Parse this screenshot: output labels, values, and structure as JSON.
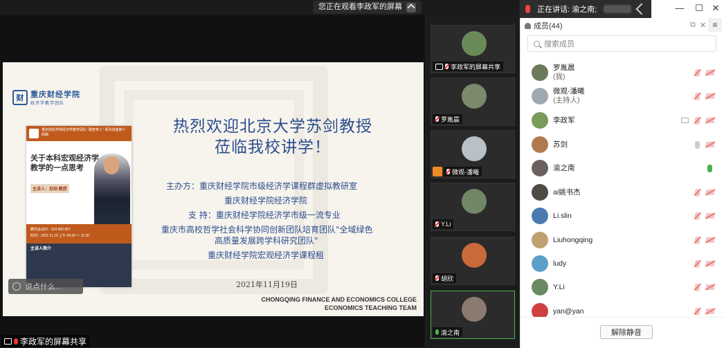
{
  "meeting": {
    "viewing_banner": "您正在观看李政军的屏幕",
    "share_label": "李政军的屏幕共享",
    "chat_placeholder": "说点什么..."
  },
  "slide": {
    "logo_name": "重庆财经学院",
    "logo_sub": "经济学教学团队",
    "poster": {
      "header": "重庆财经学院经济学教学团队 \"融智育人\" 系列讲座第十四期",
      "title": "关于本科宏观经济学教学的一点思考",
      "speaker": "主讲人：苏剑 教授",
      "meeting_id": "腾讯会议ID：524 890 867",
      "time": "时间：2021.11.19 上午 09:30 ～ 11:30",
      "bio_title": "主讲人简介"
    },
    "title_line1": "热烈欢迎北京大学苏剑教授",
    "title_line2": "莅临我校讲学！",
    "organizer_line1": "主办方：重庆财经学院市级经济学课程群虚拟教研室",
    "organizer_line2": "重庆财经学院经济学院",
    "support_line": "支 持：重庆财经学院经济学市级一流专业",
    "team_line1": "重庆市高校哲学社会科学协同创新团队培育团队\"全域绿色",
    "team_line2": "高质量发展跨学科研究团队\"",
    "team_line3": "重庆财经学院宏观经济学课程租",
    "date": "2021年11月19日",
    "en_line1": "CHONGQING FINANCE AND ECONOMICS COLLEGE",
    "en_line2": "ECONOMICS TEACHING TEAM"
  },
  "tiles": [
    {
      "name": "李政军的屏幕共享",
      "color": "#6a8a5a",
      "mic": "muted"
    },
    {
      "name": "罗胤晨",
      "color": "#7a8a6a",
      "mic": "muted"
    },
    {
      "name": "微观-潘曦",
      "color": "#b8c0c8",
      "mic": "muted"
    },
    {
      "name": "Y.Li",
      "color": "#708868",
      "mic": "muted"
    },
    {
      "name": "胡欣",
      "color": "#c86a3a",
      "mic": "muted"
    },
    {
      "name": "渝之南",
      "color": "#8a7a70",
      "mic": "green"
    }
  ],
  "panel": {
    "speaking_label": "正在讲话: 渝之南;",
    "members_title": "成员(44)",
    "search_placeholder": "搜索成员",
    "unmute_button": "解除静音",
    "members": [
      {
        "name": "罗胤晨",
        "sub": "(我)",
        "color": "#6a7a5a",
        "mic": "muted"
      },
      {
        "name": "微观-潘曦",
        "sub": "(主持人)",
        "color": "#a0a8b0",
        "mic": "muted"
      },
      {
        "name": "李政军",
        "sub": "",
        "color": "#7a9a5a",
        "mic": "muted",
        "screen": true
      },
      {
        "name": "苏剑",
        "sub": "",
        "color": "#b07a50",
        "mic": "grey"
      },
      {
        "name": "渝之南",
        "sub": "",
        "color": "#6a6060",
        "mic": "green"
      },
      {
        "name": "ai姚书杰",
        "sub": "",
        "color": "#504a44",
        "mic": "muted"
      },
      {
        "name": "Li.slin",
        "sub": "",
        "color": "#4a7ab0",
        "mic": "muted"
      },
      {
        "name": "Liuhongqing",
        "sub": "",
        "color": "#c0a070",
        "mic": "muted"
      },
      {
        "name": "ludy",
        "sub": "",
        "color": "#5aa0c8",
        "mic": "muted"
      },
      {
        "name": "Y.Li",
        "sub": "",
        "color": "#6a8a60",
        "mic": "muted"
      },
      {
        "name": "yan@yan",
        "sub": "",
        "color": "#d04040",
        "mic": "muted"
      }
    ]
  }
}
